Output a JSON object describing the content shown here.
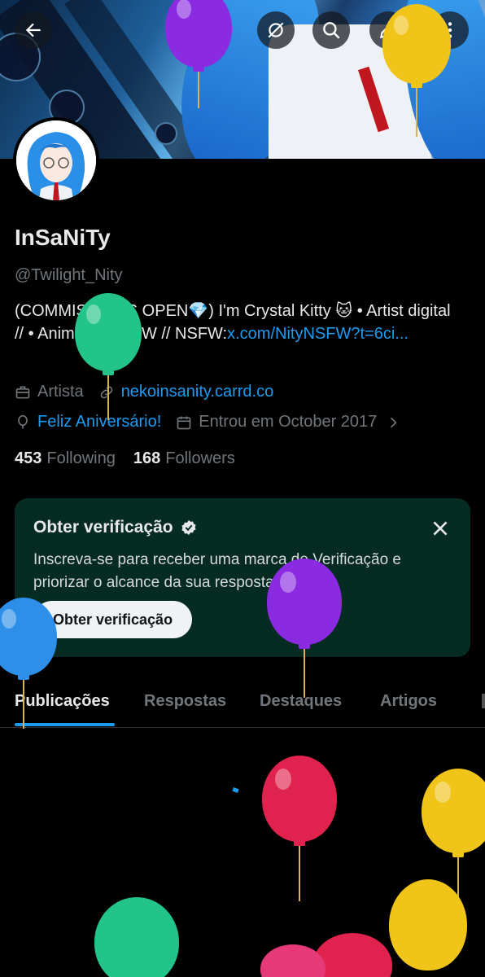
{
  "header": {
    "back_icon": "arrow-left-icon",
    "hide_icon": "eye-slash-icon",
    "search_icon": "search-icon",
    "edit_icon": "edit-icon",
    "more_icon": "more-vertical-icon"
  },
  "profile": {
    "name": "InSaNiTy",
    "handle": "@Twilight_Nity",
    "bio_text": "(COMMISSIONS OPEN💎) I'm Crystal Kitty 🐱 • Artist digital // • Animator // SFW // NSFW:",
    "bio_link": "x.com/NityNSFW?t=6ci...",
    "profession": "Artista",
    "website": "nekoinsanity.carrd.co",
    "birthday": "Feliz Aniversário!",
    "joined": "Entrou em October 2017"
  },
  "stats": {
    "following_count": "453",
    "following_label": "Following",
    "followers_count": "168",
    "followers_label": "Followers"
  },
  "verification_card": {
    "title": "Obter verificação",
    "text": "Inscreva-se para receber uma marca de Verificação e priorizar o alcance da sua resposta.",
    "button": "Obter verificação"
  },
  "tabs": [
    {
      "label": "Publicações",
      "active": true
    },
    {
      "label": "Respostas",
      "active": false
    },
    {
      "label": "Destaques",
      "active": false
    },
    {
      "label": "Artigos",
      "active": false
    }
  ],
  "colors": {
    "accent": "#1d9bf0",
    "card_bg": "#062b22",
    "balloons": [
      "#8a2be2",
      "#f0c419",
      "#22c48a",
      "#2e8fe8",
      "#e0234e"
    ]
  }
}
